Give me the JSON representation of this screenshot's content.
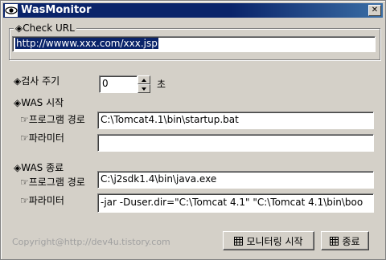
{
  "window": {
    "title": "WasMonitor",
    "close_glyph": "✕"
  },
  "check_url": {
    "legend": "◈Check URL",
    "value": "http://wwww.xxx.com/xxx.jsp"
  },
  "interval": {
    "label": "◈검사 주기",
    "value": "0",
    "unit": "초"
  },
  "was_start": {
    "heading": "◈WAS 시작",
    "program_label": "☞프로그램 경로",
    "program_value": "C:\\Tomcat4.1\\bin\\startup.bat",
    "param_label": "☞파라미터",
    "param_value": ""
  },
  "was_stop": {
    "heading": "◈WAS 종료",
    "program_label": "☞프로그램 경로",
    "program_value": "C:\\j2sdk1.4\\bin\\java.exe",
    "param_label": "☞파라미터",
    "param_value": "-jar -Duser.dir=\"C:\\Tomcat 4.1\" \"C:\\Tomcat 4.1\\bin\\boo"
  },
  "footer": {
    "copyright": "Copyright@http://dev4u.tistory.com"
  },
  "buttons": {
    "monitor": "모니터링 시작",
    "exit": "종료"
  },
  "icons": {
    "app": "eye-icon",
    "button": "grid-icon"
  }
}
